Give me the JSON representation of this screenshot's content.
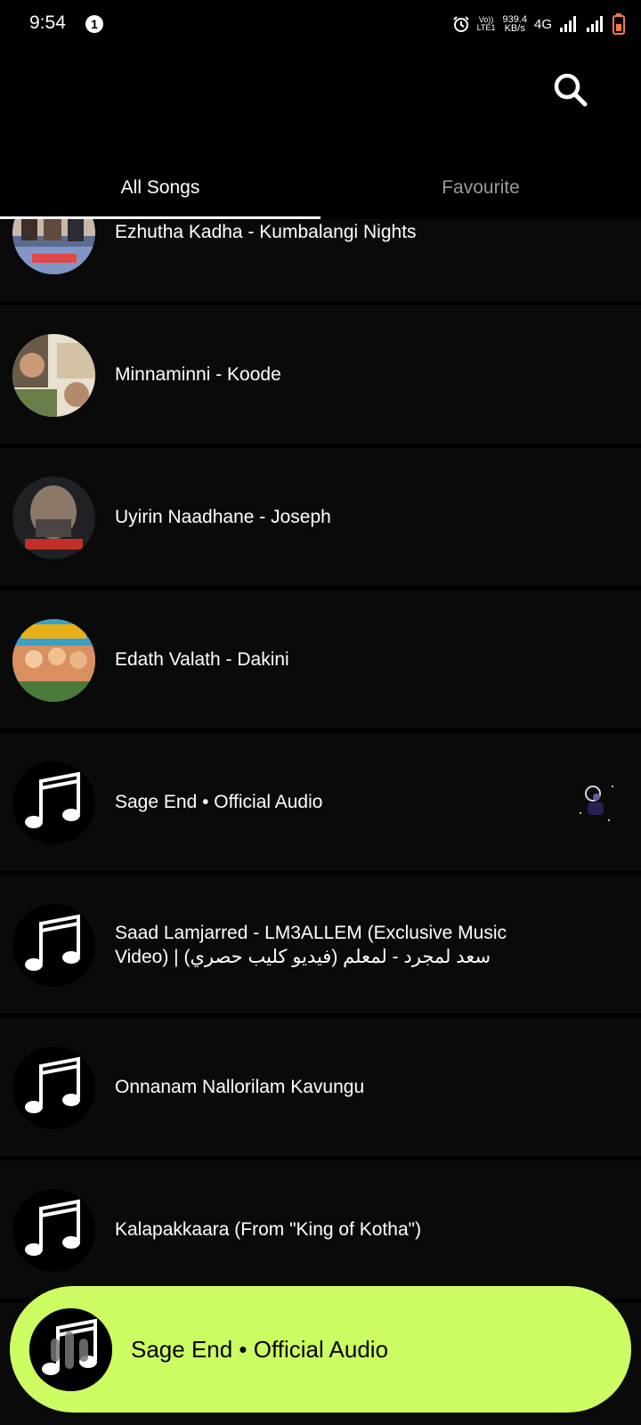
{
  "status_bar": {
    "time": "9:54",
    "notification_count": "1",
    "volte_line1": "Vo))",
    "volte_line2": "LTE1",
    "speed_value": "939.4",
    "speed_unit": "KB/s",
    "network": "4G"
  },
  "tabs": [
    {
      "label": "All Songs",
      "active": true
    },
    {
      "label": "Favourite",
      "active": false
    }
  ],
  "songs": [
    {
      "title": "Ezhutha Kadha - Kumbalangi Nights",
      "thumb": "album-art"
    },
    {
      "title": "Minnaminni - Koode",
      "thumb": "album-art"
    },
    {
      "title": "Uyirin Naadhane - Joseph",
      "thumb": "album-art"
    },
    {
      "title": "Edath Valath - Dakini",
      "thumb": "album-art"
    },
    {
      "title": "Sage End • Official Audio",
      "thumb": "music-note-icon"
    },
    {
      "title": "Saad Lamjarred - LM3ALLEM (Exclusive Music Video) |  سعد لمجرد - لمعلم (فيديو كليب حصري)",
      "thumb": "music-note-icon"
    },
    {
      "title": "Onnanam Nallorilam Kavungu",
      "thumb": "music-note-icon"
    },
    {
      "title": "Kalapakkaara (From \"King of Kotha\")",
      "thumb": "music-note-icon"
    }
  ],
  "now_playing": {
    "title": "Sage End • Official Audio"
  },
  "colors": {
    "accent": "#cdfb62",
    "background": "#000000",
    "row_background": "#0a0a0a"
  }
}
